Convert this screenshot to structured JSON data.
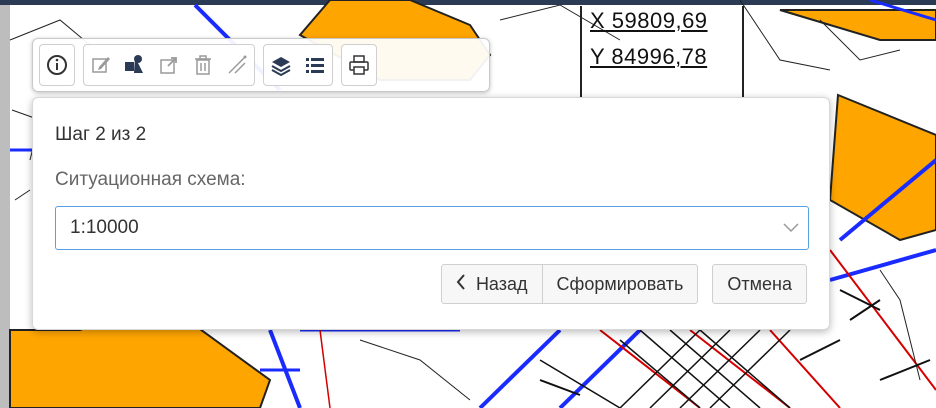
{
  "coords": {
    "x": "X 59809,69",
    "y": "Y 84996,78"
  },
  "toolbar": {
    "groups": [
      [
        "info-icon"
      ],
      [
        "edit-icon",
        "select-object-icon",
        "export-icon",
        "delete-icon",
        "measure-icon"
      ],
      [
        "layers-icon",
        "legend-list-icon"
      ],
      [
        "print-icon"
      ]
    ]
  },
  "dialog": {
    "step": "Шаг 2 из 2",
    "field_label": "Ситуационная схема:",
    "scale_value": "1:10000",
    "back_label": "Назад",
    "generate_label": "Сформировать",
    "cancel_label": "Отмена"
  },
  "colors": {
    "accent_border": "#5aa0e0",
    "parcel_fill": "#ffa500",
    "road_blue": "#1a2bff",
    "parcel_red": "#d40000"
  }
}
